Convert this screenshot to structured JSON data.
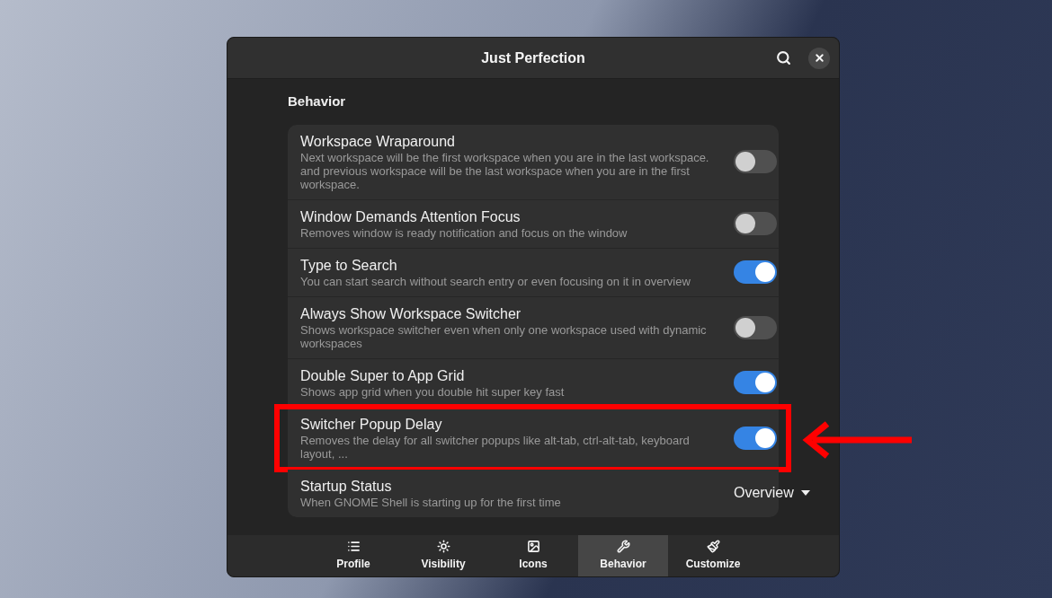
{
  "window": {
    "title": "Just Perfection"
  },
  "section_title": "Behavior",
  "rows": [
    {
      "kind": "switch",
      "title": "Workspace Wraparound",
      "description": "Next workspace will be the first workspace when you are in the last workspace. and previous workspace will be the last workspace when you are in the first workspace.",
      "on": false,
      "highlighted": false
    },
    {
      "kind": "switch",
      "title": "Window Demands Attention Focus",
      "description": "Removes window is ready notification and focus on the window",
      "on": false,
      "highlighted": false
    },
    {
      "kind": "switch",
      "title": "Type to Search",
      "description": "You can start search without search entry or even focusing on it in overview",
      "on": true,
      "highlighted": false
    },
    {
      "kind": "switch",
      "title": "Always Show Workspace Switcher",
      "description": "Shows workspace switcher even when only one workspace used with dynamic workspaces",
      "on": false,
      "highlighted": false
    },
    {
      "kind": "switch",
      "title": "Double Super to App Grid",
      "description": "Shows app grid when you double hit super key fast",
      "on": true,
      "highlighted": false
    },
    {
      "kind": "switch",
      "title": "Switcher Popup Delay",
      "description": "Removes the delay for all switcher popups like alt-tab, ctrl-alt-tab, keyboard layout, ...",
      "on": true,
      "highlighted": true
    },
    {
      "kind": "dropdown",
      "title": "Startup Status",
      "description": "When GNOME Shell is starting up for the first time",
      "value": "Overview",
      "highlighted": false
    }
  ],
  "tabs": [
    {
      "label": "Profile",
      "selected": false
    },
    {
      "label": "Visibility",
      "selected": false
    },
    {
      "label": "Icons",
      "selected": false
    },
    {
      "label": "Behavior",
      "selected": true
    },
    {
      "label": "Customize",
      "selected": false
    }
  ]
}
